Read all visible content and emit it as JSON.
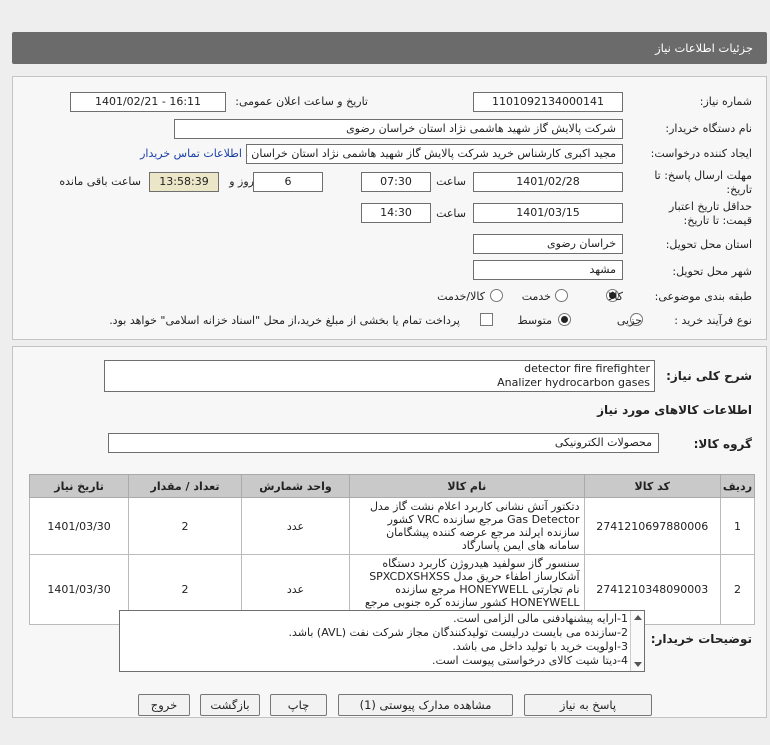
{
  "page_title": "جزئیات اطلاعات نیاز",
  "form": {
    "need_number_label": "شماره نیاز:",
    "need_number": "1101092134000141",
    "announce_label": "تاریخ و ساعت اعلان عمومی:",
    "announce_value": "1401/02/21 - 16:11",
    "buyer_org_label": "نام دستگاه خریدار:",
    "buyer_org": "شرکت پالایش گاز شهید هاشمی نژاد   استان خراسان رضوی",
    "creator_label": "ایجاد کننده درخواست:",
    "creator": "مجید اکبری کارشناس خرید شرکت پالایش گاز شهید هاشمی نژاد   استان خراسان رضوی",
    "contact_link": "اطلاعات تماس خریدار",
    "deadline_label_1": "مهلت ارسال پاسخ: تا",
    "deadline_label_2": "تاریخ:",
    "deadline_date": "1401/02/28",
    "time_label": "ساعت",
    "deadline_time": "07:30",
    "days_value": "6",
    "days_label": "روز و",
    "remaining_time": "13:58:39",
    "remaining_label": "ساعت باقی مانده",
    "validity_label_1": "حداقل تاریخ اعتبار",
    "validity_label_2": "قیمت: تا تاریخ:",
    "validity_date": "1401/03/15",
    "validity_time": "14:30",
    "province_label": "استان محل تحویل:",
    "province": "خراسان رضوی",
    "city_label": "شهر محل تحویل:",
    "city": "مشهد",
    "category_label": "طبقه بندی موضوعی:",
    "category_options": [
      "کالا",
      "خدمت",
      "کالا/خدمت"
    ],
    "process_label": "نوع فرآیند خرید :",
    "process_options": [
      "جزیی",
      "متوسط"
    ],
    "payment_note": "پرداخت تمام یا بخشی از مبلغ خرید،از محل \"اسناد خزانه اسلامی\" خواهد بود."
  },
  "need": {
    "desc_label": "شرح کلی نیاز:",
    "desc_line1": "detector fire firefighter",
    "desc_line2": "Analizer hydrocarbon gases",
    "goods_header": "اطلاعات کالاهای مورد نیاز",
    "group_label": "گروه کالا:",
    "group_value": "محصولات الکترونیکی"
  },
  "table": {
    "headers": [
      "ردیف",
      "کد کالا",
      "نام کالا",
      "واحد شمارش",
      "تعداد / مقدار",
      "تاریخ نیاز"
    ],
    "rows": [
      {
        "idx": "1",
        "code": "2741210697880006",
        "name": "دتکتور آتش نشانی کاربرد اعلام نشت گاز مدل Gas Detector مرجع سازنده VRC کشور سازنده ایرلند مرجع عرضه کننده پیشگامان سامانه های ایمن پاسارگاد",
        "unit": "عدد",
        "qty": "2",
        "date": "1401/03/30"
      },
      {
        "idx": "2",
        "code": "2741210348090003",
        "name": "سنسور گاز سولفید هیدروژن کاربرد دستگاه آشکارساز اطفاء حریق مدل SPXCDXSHXSS نام تجارتی HONEYWELL مرجع سازنده HONEYWELL کشور سازنده کره جنوبی مرجع عرضه کننده زادمان صنعت تات",
        "unit": "عدد",
        "qty": "2",
        "date": "1401/03/30"
      }
    ]
  },
  "notes": {
    "label": "توضیحات خریدار:",
    "lines": [
      "1-ارایه پیشنهادفنی مالی الزامی است.",
      "2-سازنده می بایست درلیست تولیدکنندگان مجاز شرکت نفت (AVL)  باشد.",
      "3-اولویت خرید با  تولید داخل می باشد.",
      "4-دیتا شیت کالای درخواستی پیوست است."
    ]
  },
  "buttons": {
    "reply": "پاسخ به نیاز",
    "attachments": "مشاهده مدارک پیوستی (1)",
    "print": "چاپ",
    "back": "بازگشت",
    "exit": "خروج"
  },
  "colors": {
    "title_bar": "#6b6b6b",
    "link": "#1a3fa8",
    "remaining_bg": "#ece6c8",
    "table_header": "#c9c9c9"
  }
}
